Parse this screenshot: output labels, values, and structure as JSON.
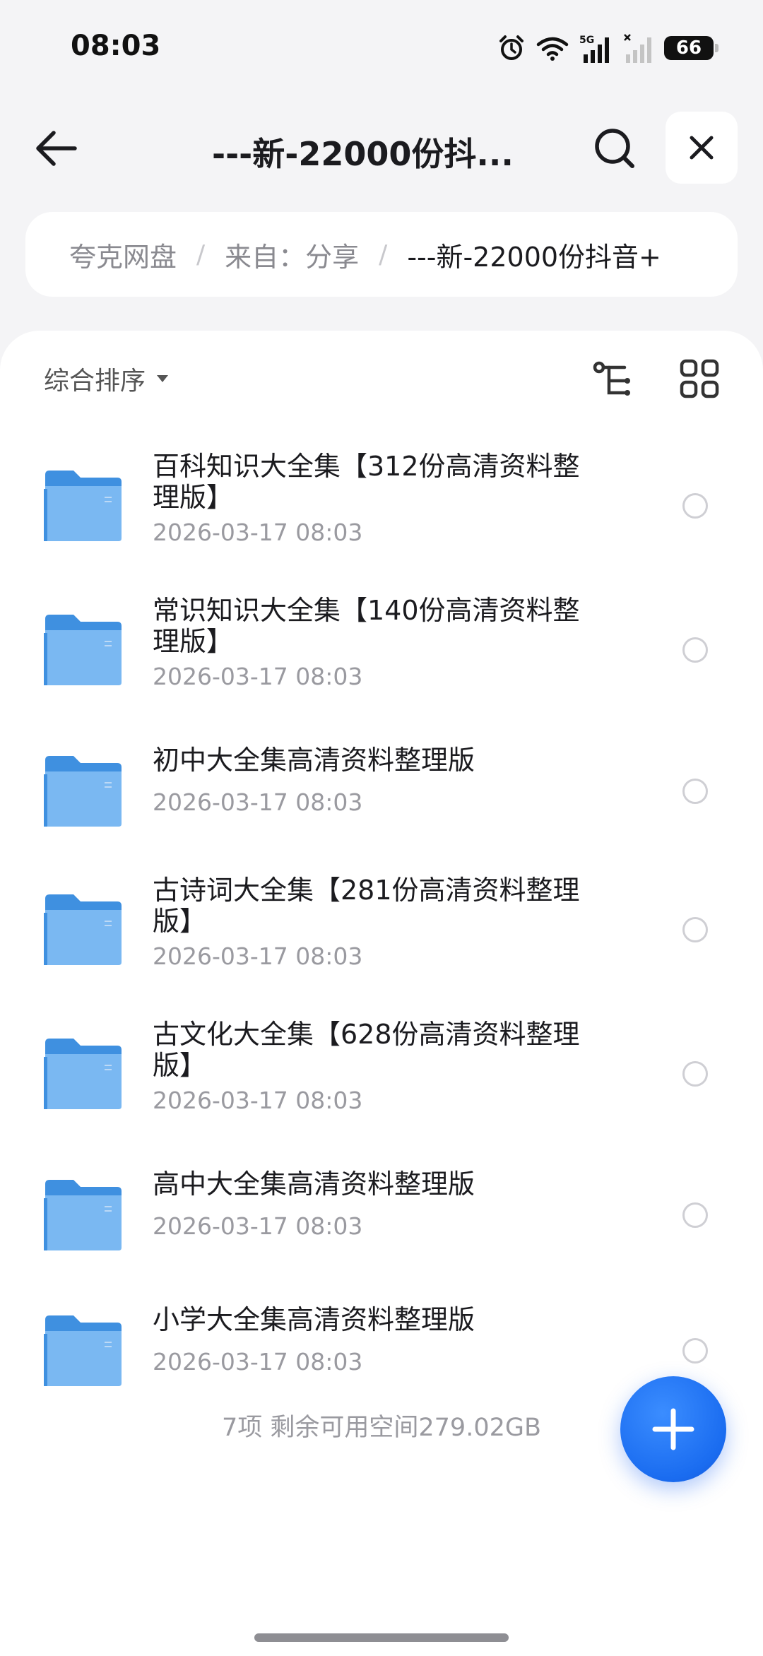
{
  "status_bar": {
    "time": "08:03",
    "battery": "66",
    "network_label": "5G"
  },
  "header": {
    "title": "---新-22000份抖..."
  },
  "breadcrumb": [
    "夸克网盘",
    "来自：分享",
    "---新-22000份抖音+"
  ],
  "breadcrumb_separator": "/",
  "toolbar": {
    "sort_label": "综合排序"
  },
  "files": [
    {
      "name": "百科知识大全集【312份高清资料整理版】",
      "date": "2026-03-17 08:03"
    },
    {
      "name": "常识知识大全集【140份高清资料整理版】",
      "date": "2026-03-17 08:03"
    },
    {
      "name": "初中大全集高清资料整理版",
      "date": "2026-03-17 08:03"
    },
    {
      "name": "古诗词大全集【281份高清资料整理版】",
      "date": "2026-03-17 08:03"
    },
    {
      "name": "古文化大全集【628份高清资料整理版】",
      "date": "2026-03-17 08:03"
    },
    {
      "name": "高中大全集高清资料整理版",
      "date": "2026-03-17 08:03"
    },
    {
      "name": "小学大全集高清资料整理版",
      "date": "2026-03-17 08:03"
    }
  ],
  "footer": {
    "summary": "7项 剩余可用空间279.02GB"
  },
  "colors": {
    "accent": "#1a6cf0",
    "folder": "#5aa9f0",
    "background": "#f4f4f6"
  },
  "icons": {
    "back": "arrow-left-icon",
    "search": "search-icon",
    "close": "close-icon",
    "tree": "tree-view-icon",
    "grid": "grid-view-icon",
    "folder": "folder-icon",
    "add": "plus-icon"
  }
}
